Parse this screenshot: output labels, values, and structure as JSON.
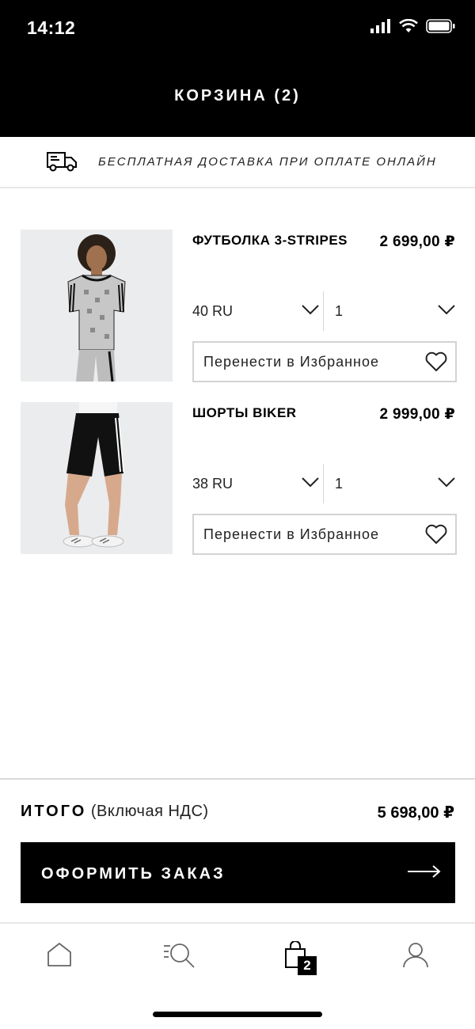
{
  "status_bar": {
    "time": "14:12"
  },
  "header": {
    "title": "КОРЗИНА (2)"
  },
  "promo": {
    "text": "БЕСПЛАТНАЯ ДОСТАВКА ПРИ ОПЛАТЕ ОНЛАЙН"
  },
  "cart": {
    "items": [
      {
        "name": "ФУТБОЛКА 3-STRIPES",
        "price": "2 699,00 ₽",
        "size": "40 RU",
        "quantity": "1",
        "wishlist_label": "Перенести в Избранное"
      },
      {
        "name": "ШОРТЫ BIKER",
        "price": "2 999,00 ₽",
        "size": "38 RU",
        "quantity": "1",
        "wishlist_label": "Перенести в Избранное"
      }
    ]
  },
  "summary": {
    "total_label": "ИТОГО",
    "total_sub": "(Включая НДС)",
    "total_price": "5 698,00 ₽"
  },
  "checkout": {
    "label": "ОФОРМИТЬ ЗАКАЗ"
  },
  "tabbar": {
    "cart_badge": "2"
  },
  "colors": {
    "header_bg": "#000000",
    "image_bg": "#ebecee"
  }
}
